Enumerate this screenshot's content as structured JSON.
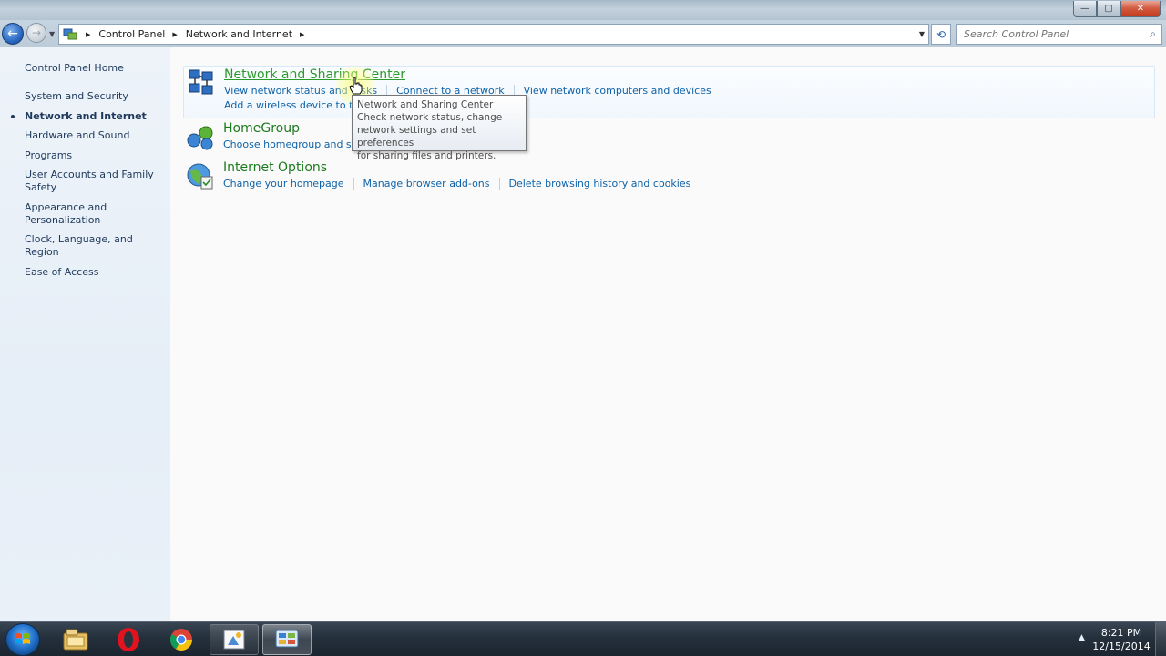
{
  "window": {
    "minimize_glyph": "—",
    "maximize_glyph": "▢",
    "close_glyph": "✕"
  },
  "navbar": {
    "back_glyph": "←",
    "forward_glyph": "→",
    "breadcrumb": [
      "Control Panel",
      "Network and Internet"
    ],
    "search_placeholder": "Search Control Panel",
    "refresh_glyph": "⟲",
    "search_glyph": "⌕"
  },
  "sidebar": {
    "home": "Control Panel Home",
    "items": [
      {
        "label": "System and Security"
      },
      {
        "label": "Network and Internet",
        "active": true
      },
      {
        "label": "Hardware and Sound"
      },
      {
        "label": "Programs"
      },
      {
        "label": "User Accounts and Family Safety"
      },
      {
        "label": "Appearance and Personalization"
      },
      {
        "label": "Clock, Language, and Region"
      },
      {
        "label": "Ease of Access"
      }
    ]
  },
  "categories": [
    {
      "title": "Network and Sharing Center",
      "icon": "network-sharing-icon",
      "links_row1": [
        "View network status and tasks",
        "Connect to a network",
        "View network computers and devices"
      ],
      "links_row2": [
        "Add a wireless device to the network"
      ]
    },
    {
      "title": "HomeGroup",
      "icon": "homegroup-icon",
      "links_row1": [
        "Choose homegroup and sharing options"
      ]
    },
    {
      "title": "Internet Options",
      "icon": "internet-options-icon",
      "links_row1": [
        "Change your homepage",
        "Manage browser add-ons",
        "Delete browsing history and cookies"
      ]
    }
  ],
  "tooltip": {
    "title": "Network and Sharing Center",
    "lines": [
      "Check network status, change",
      "network settings and set preferences",
      "for sharing files and printers."
    ]
  },
  "taskbar": {
    "apps": [
      "file-explorer-icon",
      "opera-icon",
      "chrome-icon",
      "paint-icon",
      "control-panel-icon"
    ],
    "tray_up_glyph": "▲",
    "time": "8:21 PM",
    "date": "12/15/2014"
  },
  "colors": {
    "accent_link": "#0e62a8",
    "category_title": "#1e7a1e",
    "sidebar_text": "#1e395b"
  }
}
